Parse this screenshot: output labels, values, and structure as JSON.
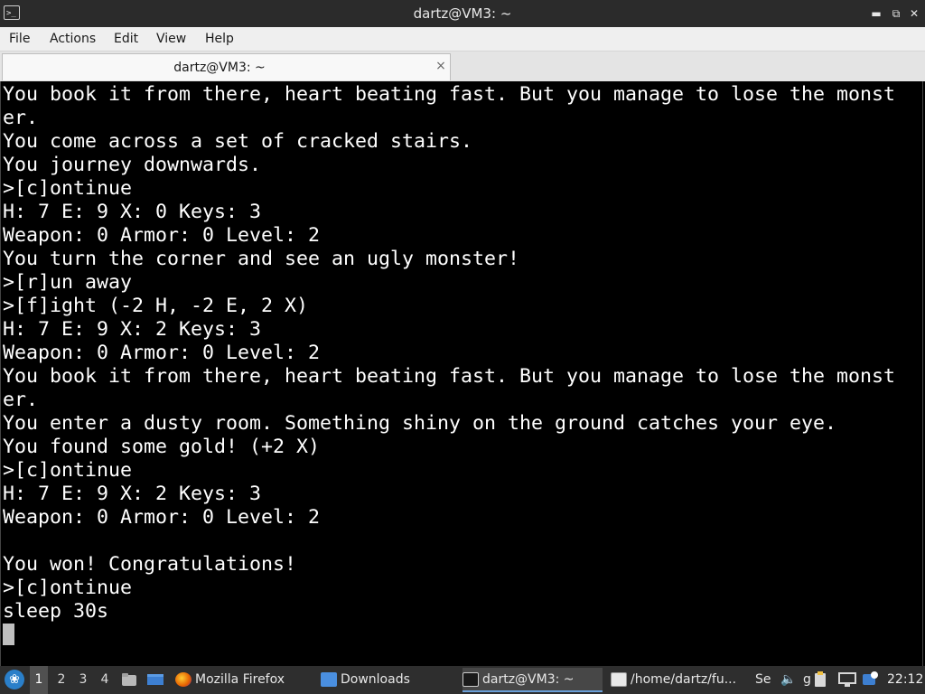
{
  "window": {
    "title": "dartz@VM3: ~"
  },
  "menu": [
    "File",
    "Actions",
    "Edit",
    "View",
    "Help"
  ],
  "tab": {
    "label": "dartz@VM3: ~",
    "close_glyph": "×"
  },
  "terminal": {
    "lines": [
      "You book it from there, heart beating fast. But you manage to lose the monst",
      "er.",
      "You come across a set of cracked stairs.",
      "You journey downwards.",
      ">[c]ontinue",
      "H: 7 E: 9 X: 0 Keys: 3",
      "Weapon: 0 Armor: 0 Level: 2",
      "You turn the corner and see an ugly monster!",
      ">[r]un away",
      ">[f]ight (-2 H, -2 E, 2 X)",
      "H: 7 E: 9 X: 2 Keys: 3",
      "Weapon: 0 Armor: 0 Level: 2",
      "You book it from there, heart beating fast. But you manage to lose the monst",
      "er.",
      "You enter a dusty room. Something shiny on the ground catches your eye.",
      "You found some gold! (+2 X)",
      ">[c]ontinue",
      "H: 7 E: 9 X: 2 Keys: 3",
      "Weapon: 0 Armor: 0 Level: 2",
      "",
      "You won! Congratulations!",
      ">[c]ontinue",
      "sleep 30s"
    ]
  },
  "taskbar": {
    "workspaces": [
      "1",
      "2",
      "3",
      "4"
    ],
    "active_workspace": "1",
    "tasks": [
      {
        "label": "Mozilla Firefox",
        "icon": "firefox-icon"
      },
      {
        "label": "Downloads",
        "icon": "folder-icon"
      },
      {
        "label": "dartz@VM3: ~",
        "icon": "terminal-icon"
      },
      {
        "label": "/home/dartz/fu...",
        "icon": "text-editor-icon"
      }
    ],
    "tray_fragments": {
      "se": "Se",
      "g": "g"
    },
    "clock": "22:12"
  },
  "colors": {
    "terminal_bg": "#000000",
    "terminal_fg": "#ffffff",
    "titlebar_bg": "#2b2b2b",
    "taskbar_bg": "#2e2e2e",
    "start_button": "#2a7fc9"
  }
}
